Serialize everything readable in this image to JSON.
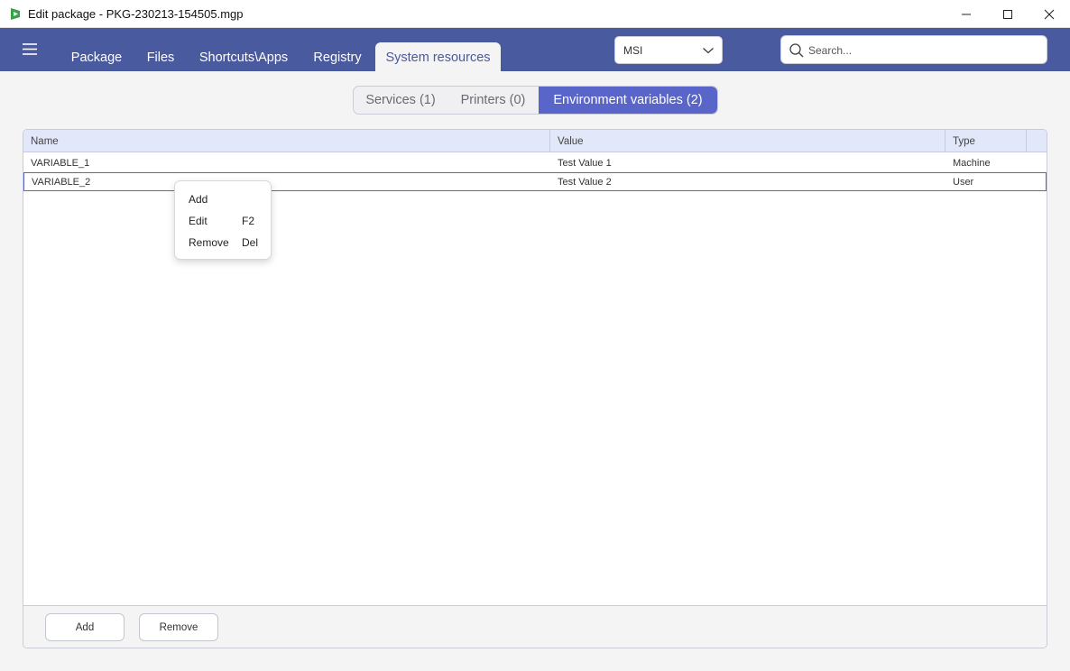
{
  "window": {
    "title": "Edit package - PKG-230213-154505.mgp",
    "accent": "#4a5a9e",
    "highlight": "#5965c9"
  },
  "header": {
    "tabs": [
      {
        "label": "Package"
      },
      {
        "label": "Files"
      },
      {
        "label": "Shortcuts\\Apps"
      },
      {
        "label": "Registry"
      },
      {
        "label": "System resources"
      }
    ],
    "active_tab": "System resources",
    "package_type": "MSI",
    "search_placeholder": "Search..."
  },
  "subtabs": [
    {
      "label": "Services (1)"
    },
    {
      "label": "Printers (0)"
    },
    {
      "label": "Environment variables (2)"
    }
  ],
  "active_subtab": "Environment variables (2)",
  "table": {
    "columns": [
      "Name",
      "Value",
      "Type"
    ],
    "rows": [
      {
        "name": "VARIABLE_1",
        "value": "Test Value 1",
        "type": "Machine"
      },
      {
        "name": "VARIABLE_2",
        "value": "Test Value 2",
        "type": "User"
      }
    ],
    "selected_row": "VARIABLE_2"
  },
  "footer": {
    "add_label": "Add",
    "remove_label": "Remove"
  },
  "context_menu": {
    "items": [
      {
        "label": "Add",
        "shortcut": ""
      },
      {
        "label": "Edit",
        "shortcut": "F2"
      },
      {
        "label": "Remove",
        "shortcut": "Del"
      }
    ]
  }
}
